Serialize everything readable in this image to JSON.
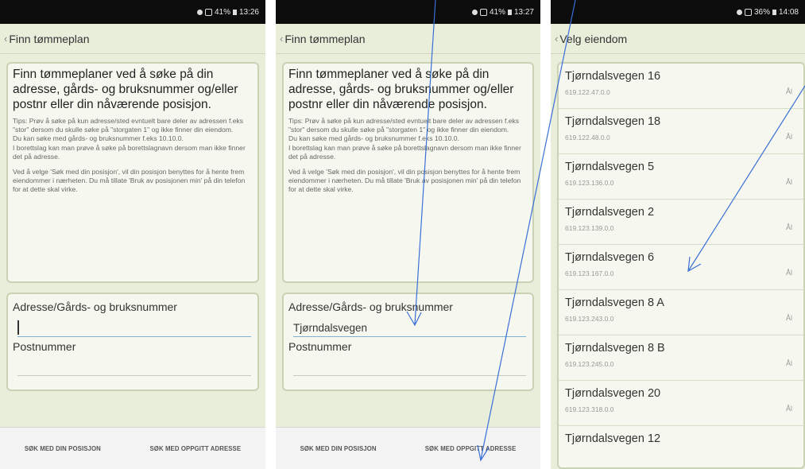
{
  "screens": [
    {
      "status_time": "13:26",
      "status_battery": "41%",
      "title": "Finn tømmeplan",
      "info_heading": "Finn tømmeplaner ved å søke på din adresse, gårds- og bruksnummer og/eller postnr eller din nåværende posisjon.",
      "tip1": "Tips: Prøv å søke på kun adresse/sted evntuelt bare deler av adressen f.eks \"stor\" dersom du skulle søke på \"storgaten 1\" og ikke finner din eiendom.",
      "tip2": "Du kan søke med gårds- og bruksnummer f.eks 10.10.0.",
      "tip3": "I borettslag kan man prøve å søke på borettslagnavn dersom man ikke finner det på adresse.",
      "tip4": "Ved å velge 'Søk med din posisjon', vil din posisjon benyttes for å hente frem eiendommer i nærheten. Du må tillate 'Bruk av posisjonen min' på din telefon for at dette skal virke.",
      "address_label": "Adresse/Gårds- og bruksnummer",
      "address_value": "",
      "postal_label": "Postnummer",
      "btn_position": "SØK MED DIN POSISJON",
      "btn_address": "SØK MED OPPGITT ADRESSE"
    },
    {
      "status_time": "13:27",
      "status_battery": "41%",
      "title": "Finn tømmeplan",
      "info_heading": "Finn tømmeplaner ved å søke på din adresse, gårds- og bruksnummer og/eller postnr eller din nåværende posisjon.",
      "tip1": "Tips: Prøv å søke på kun adresse/sted evntuelt bare deler av adressen f.eks \"stor\" dersom du skulle søke på \"storgaten 1\" og ikke finner din eiendom.",
      "tip2": "Du kan søke med gårds- og bruksnummer f.eks 10.10.0.",
      "tip3": "I borettslag kan man prøve å søke på borettslagnavn dersom man ikke finner det på adresse.",
      "tip4": "Ved å velge 'Søk med din posisjon', vil din posisjon benyttes for å hente frem eiendommer i nærheten. Du må tillate 'Bruk av posisjonen min' på din telefon for at dette skal virke.",
      "address_label": "Adresse/Gårds- og bruksnummer",
      "address_value": "Tjørndalsvegen",
      "postal_label": "Postnummer",
      "btn_position": "SØK MED DIN POSISJON",
      "btn_address": "SØK MED OPPGITT ADRESSE"
    },
    {
      "status_time": "14:08",
      "status_battery": "36%",
      "title": "Velg eiendom",
      "items": [
        {
          "name": "Tjørndalsvegen 16",
          "number": "619.122.47.0.0",
          "tag": "Ål"
        },
        {
          "name": "Tjørndalsvegen 18",
          "number": "619.122.48.0.0",
          "tag": "Ål"
        },
        {
          "name": "Tjørndalsvegen 5",
          "number": "619.123.136.0.0",
          "tag": "Ål"
        },
        {
          "name": "Tjørndalsvegen 2",
          "number": "619.123.139.0.0",
          "tag": "Ål"
        },
        {
          "name": "Tjørndalsvegen 6",
          "number": "619.123.167.0.0",
          "tag": "Ål"
        },
        {
          "name": "Tjørndalsvegen 8 A",
          "number": "619.123.243.0.0",
          "tag": "Ål"
        },
        {
          "name": "Tjørndalsvegen 8 B",
          "number": "619.123.245.0.0",
          "tag": "Ål"
        },
        {
          "name": "Tjørndalsvegen 20",
          "number": "619.123.318.0.0",
          "tag": "Ål"
        },
        {
          "name": "Tjørndalsvegen 12",
          "number": "",
          "tag": ""
        }
      ]
    }
  ],
  "colors": {
    "accent": "#3a6fd8",
    "background": "#e9eedb",
    "panel": "#f6f8ef",
    "border": "#c9d3b4"
  }
}
